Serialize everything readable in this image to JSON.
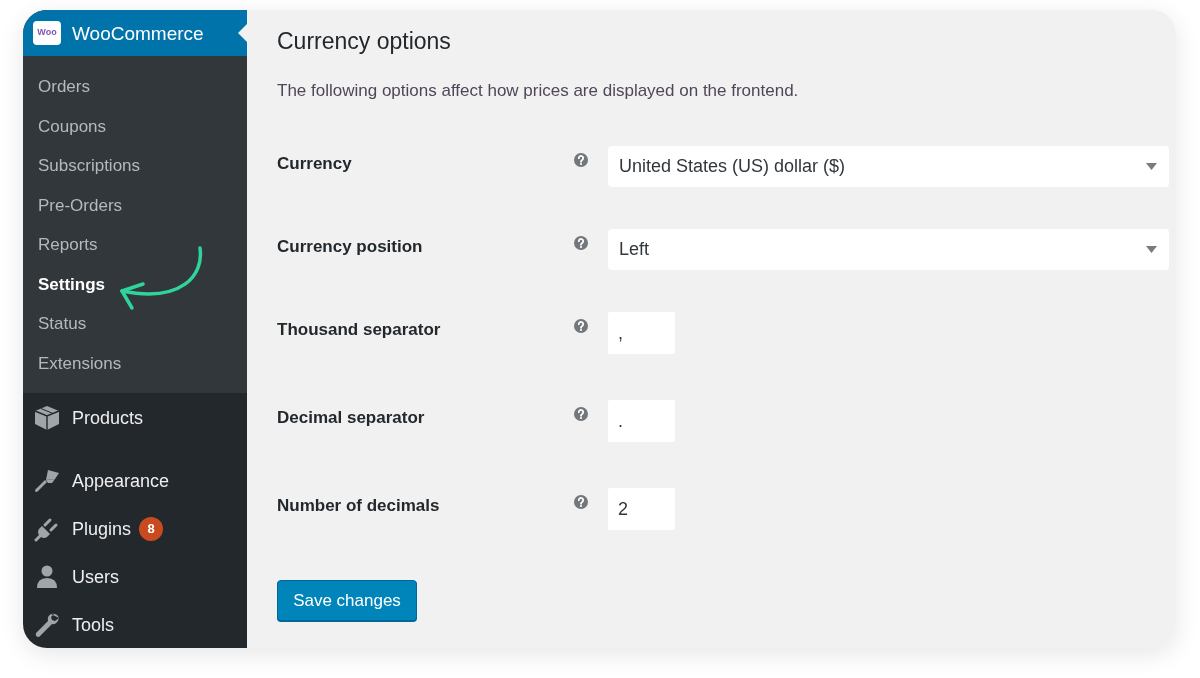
{
  "sidebar": {
    "menu": [
      {
        "label": "WooCommerce",
        "logo_text": "Woo",
        "selected": true,
        "submenu": [
          {
            "label": "Orders",
            "selected": false
          },
          {
            "label": "Coupons",
            "selected": false
          },
          {
            "label": "Subscriptions",
            "selected": false
          },
          {
            "label": "Pre-Orders",
            "selected": false
          },
          {
            "label": "Reports",
            "selected": false
          },
          {
            "label": "Settings",
            "selected": true
          },
          {
            "label": "Status",
            "selected": false
          },
          {
            "label": "Extensions",
            "selected": false
          }
        ]
      },
      {
        "label": "Products",
        "selected": false
      },
      {
        "label": "Appearance",
        "selected": false
      },
      {
        "label": "Plugins",
        "selected": false,
        "badge": "8"
      },
      {
        "label": "Users",
        "selected": false
      },
      {
        "label": "Tools",
        "selected": false
      }
    ]
  },
  "content": {
    "title": "Currency options",
    "description": "The following options affect how prices are displayed on the frontend.",
    "fields": [
      {
        "kind": "select",
        "label": "Currency",
        "value": "United States (US) dollar ($)"
      },
      {
        "kind": "select",
        "label": "Currency position",
        "value": "Left"
      },
      {
        "kind": "text",
        "label": "Thousand separator",
        "value": ","
      },
      {
        "kind": "text",
        "label": "Decimal separator",
        "value": "."
      },
      {
        "kind": "text",
        "label": "Number of decimals",
        "value": "2"
      }
    ],
    "save_button": "Save changes"
  }
}
